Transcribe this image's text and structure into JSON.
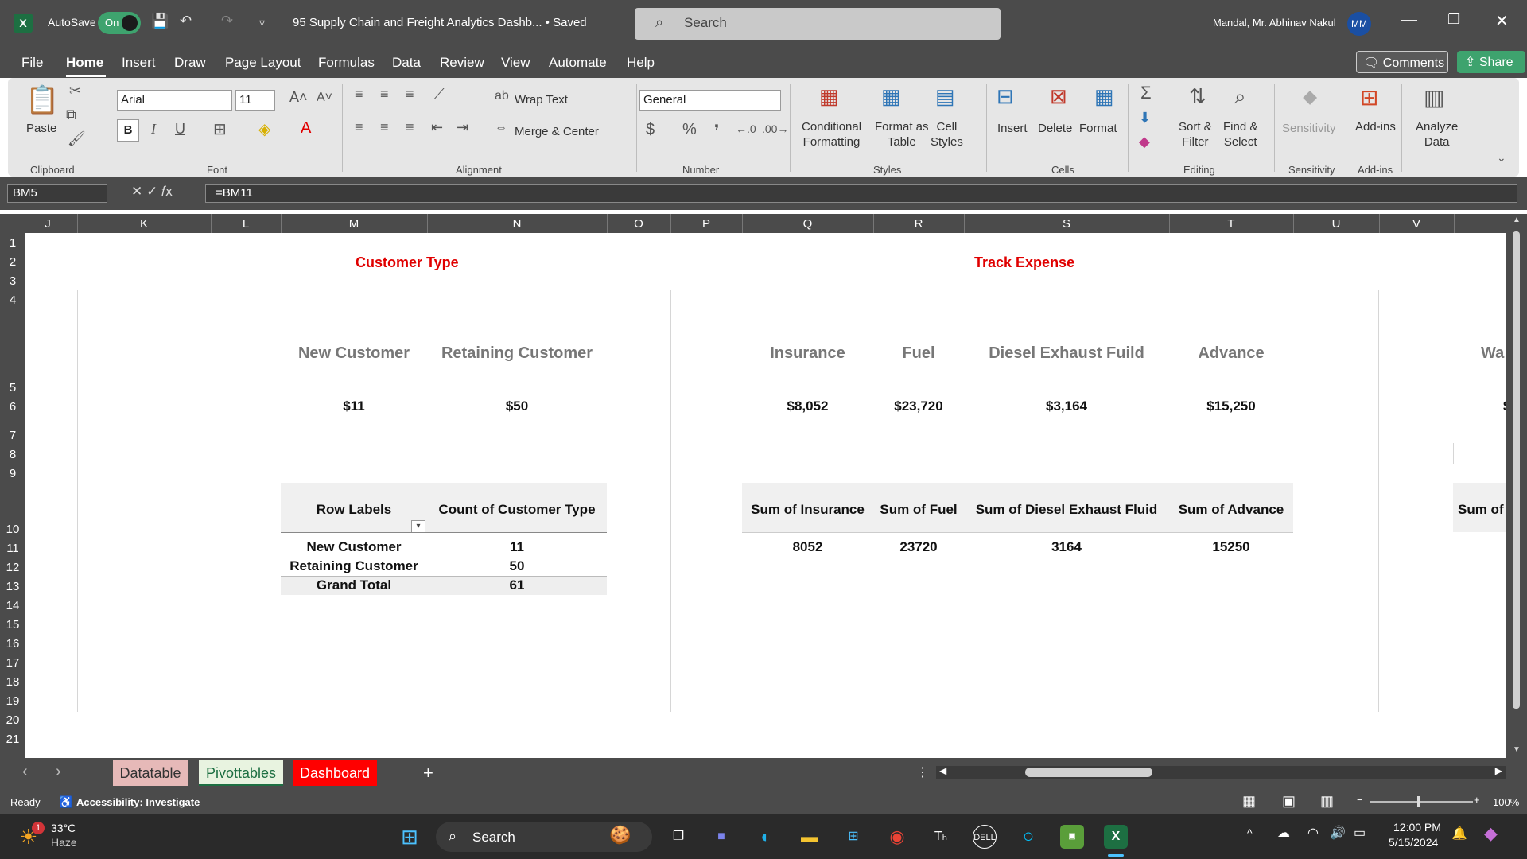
{
  "titlebar": {
    "autosave": "AutoSave",
    "toggle": "On",
    "doc_title": "95 Supply Chain and Freight Analytics Dashb...  • Saved",
    "search": "Search",
    "user": "Mandal, Mr. Abhinav Nakul",
    "avatar": "MM"
  },
  "menu": [
    "File",
    "Home",
    "Insert",
    "Draw",
    "Page Layout",
    "Formulas",
    "Data",
    "Review",
    "View",
    "Automate",
    "Help"
  ],
  "menu_right": {
    "comments": "Comments",
    "share": "Share"
  },
  "ribbon": {
    "paste": "Paste",
    "clipboard": "Clipboard",
    "font": "Arial",
    "size": "11",
    "font_group": "Font",
    "wrap": "Wrap Text",
    "merge": "Merge & Center",
    "alignment": "Alignment",
    "number_format": "General",
    "number": "Number",
    "cond": "Conditional",
    "cond2": "Formatting",
    "fmt_table": "Format as",
    "fmt_table2": "Table",
    "cell_styles": "Cell",
    "cell_styles2": "Styles",
    "styles": "Styles",
    "insert": "Insert",
    "delete": "Delete",
    "format": "Format",
    "cells": "Cells",
    "sort": "Sort &",
    "sort2": "Filter",
    "find": "Find &",
    "find2": "Select",
    "editing": "Editing",
    "sensitivity": "Sensitivity",
    "sensitivity_group": "Sensitivity",
    "addins": "Add-ins",
    "addins_group": "Add-ins",
    "analyze": "Analyze",
    "analyze2": "Data"
  },
  "formula_bar": {
    "name_box": "BM5",
    "formula": "=BM11"
  },
  "columns": [
    "J",
    "K",
    "L",
    "M",
    "N",
    "O",
    "P",
    "Q",
    "R",
    "S",
    "T",
    "U",
    "V"
  ],
  "rows": [
    "1",
    "2",
    "3",
    "4",
    "5",
    "6",
    "7",
    "8",
    "9",
    "10",
    "11",
    "12",
    "13",
    "14",
    "15",
    "16",
    "17",
    "18",
    "19",
    "20",
    "21"
  ],
  "sheet": {
    "customer_title": "Customer Type",
    "track_title": "Track Expense",
    "cards_left": [
      {
        "label": "New Customer",
        "value": "$11"
      },
      {
        "label": "Retaining Customer",
        "value": "$50"
      }
    ],
    "cards_right": [
      {
        "label": "Insurance",
        "value": "$8,052"
      },
      {
        "label": "Fuel",
        "value": "$23,720"
      },
      {
        "label": "Diesel Exhaust Fuild",
        "value": "$3,164"
      },
      {
        "label": "Advance",
        "value": "$15,250"
      }
    ],
    "cut_label": "Wa",
    "cut_value": "$",
    "pivot1": {
      "headers": [
        "Row Labels",
        "Count of Customer Type"
      ],
      "rows": [
        [
          "New Customer",
          "11"
        ],
        [
          "Retaining Customer",
          "50"
        ],
        [
          "Grand Total",
          "61"
        ]
      ]
    },
    "pivot2": {
      "headers": [
        "Sum of Insurance",
        "Sum of Fuel",
        "Sum of Diesel Exhaust Fluid",
        "Sum of Advance"
      ],
      "values": [
        "8052",
        "23720",
        "3164",
        "15250"
      ],
      "cut": "Sum of"
    }
  },
  "tabs": [
    "Datatable",
    "Pivottables",
    "Dashboard"
  ],
  "status": {
    "ready": "Ready",
    "accessibility": "Accessibility: Investigate",
    "zoom": "100%"
  },
  "taskbar": {
    "temp": "33°C",
    "weather": "Haze",
    "search": "Search",
    "time": "12:00 PM",
    "date": "5/15/2024"
  }
}
